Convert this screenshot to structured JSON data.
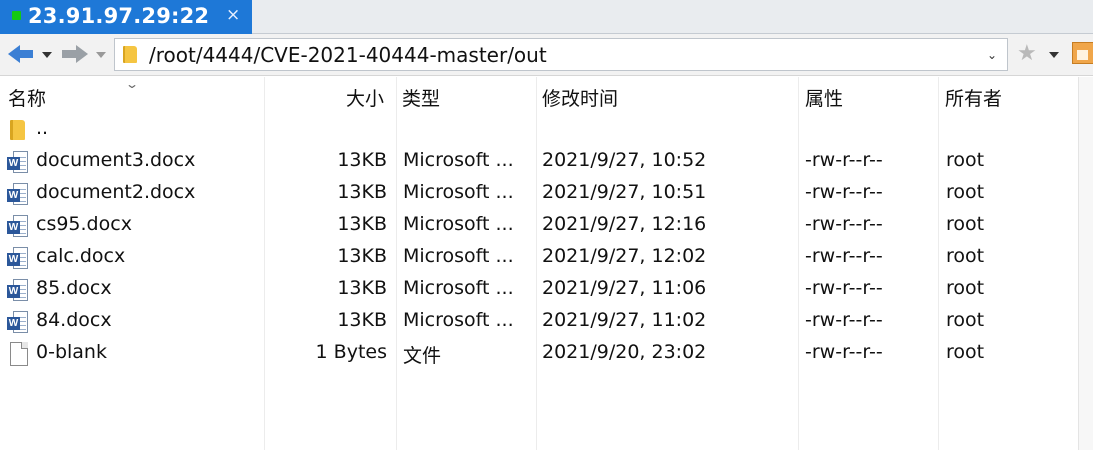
{
  "tab": {
    "title": "23.91.97.29:22",
    "close_glyph": "×"
  },
  "address": {
    "path": "/root/4444/CVE-2021-40444-master/out",
    "dropdown_glyph": "⌄"
  },
  "columns": {
    "name": "名称",
    "size": "大小",
    "type": "类型",
    "modified": "修改时间",
    "attributes": "属性",
    "owner": "所有者"
  },
  "files": [
    {
      "icon": "folder-icon",
      "name": "..",
      "size": "",
      "type": "",
      "modified": "",
      "attributes": "",
      "owner": ""
    },
    {
      "icon": "word-doc-icon",
      "name": "document3.docx",
      "size": "13KB",
      "type": "Microsoft ...",
      "modified": "2021/9/27, 10:52",
      "attributes": "-rw-r--r--",
      "owner": "root"
    },
    {
      "icon": "word-doc-icon",
      "name": "document2.docx",
      "size": "13KB",
      "type": "Microsoft ...",
      "modified": "2021/9/27, 10:51",
      "attributes": "-rw-r--r--",
      "owner": "root"
    },
    {
      "icon": "word-doc-icon",
      "name": "cs95.docx",
      "size": "13KB",
      "type": "Microsoft ...",
      "modified": "2021/9/27, 12:16",
      "attributes": "-rw-r--r--",
      "owner": "root"
    },
    {
      "icon": "word-doc-icon",
      "name": "calc.docx",
      "size": "13KB",
      "type": "Microsoft ...",
      "modified": "2021/9/27, 12:02",
      "attributes": "-rw-r--r--",
      "owner": "root"
    },
    {
      "icon": "word-doc-icon",
      "name": "85.docx",
      "size": "13KB",
      "type": "Microsoft ...",
      "modified": "2021/9/27, 11:06",
      "attributes": "-rw-r--r--",
      "owner": "root"
    },
    {
      "icon": "word-doc-icon",
      "name": "84.docx",
      "size": "13KB",
      "type": "Microsoft ...",
      "modified": "2021/9/27, 11:02",
      "attributes": "-rw-r--r--",
      "owner": "root"
    },
    {
      "icon": "blank-file-icon",
      "name": "0-blank",
      "size": "1 Bytes",
      "type": "文件",
      "modified": "2021/9/20, 23:02",
      "attributes": "-rw-r--r--",
      "owner": "root"
    }
  ],
  "colors": {
    "tab_active": "#1e78d7",
    "connected": "#14c814",
    "word_badge": "#2b579a",
    "folder": "#f5c542"
  }
}
